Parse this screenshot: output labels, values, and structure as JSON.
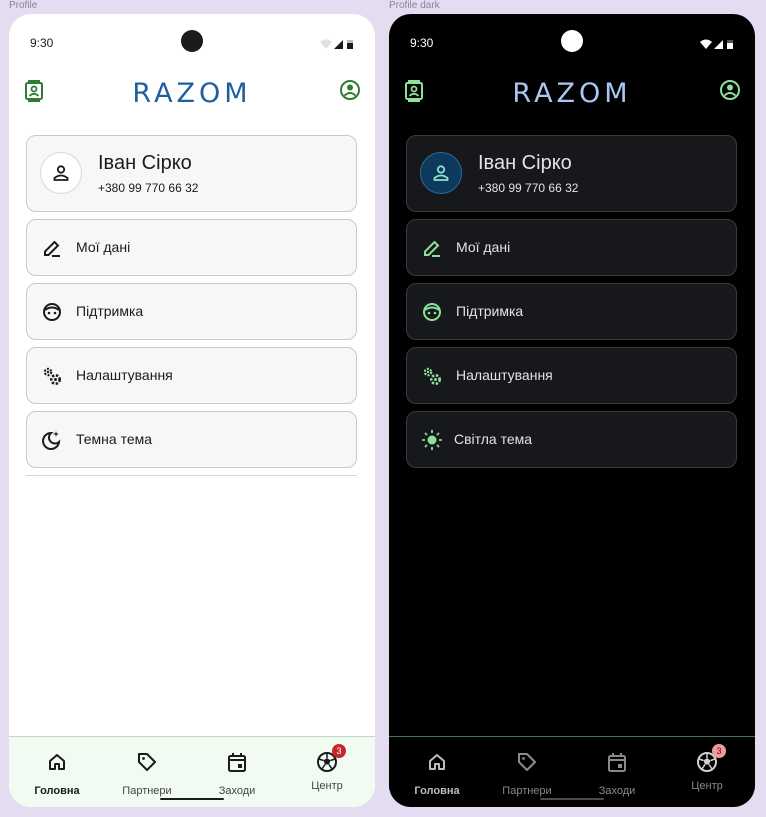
{
  "frames": {
    "light_label": "Profile",
    "dark_label": "Profile dark"
  },
  "status": {
    "time": "9:30"
  },
  "app": {
    "logo": "RAZOM"
  },
  "profile": {
    "name": "Іван Сірко",
    "phone": "+380 99 770 66 32"
  },
  "menu": {
    "my_data": "Мої дані",
    "support": "Підтримка",
    "settings": "Налаштування",
    "dark_theme": "Темна тема",
    "light_theme": "Світла тема"
  },
  "nav": {
    "home": "Головна",
    "partners": "Партнери",
    "events": "Заходи",
    "center": "Центр",
    "center_badge": "3"
  },
  "colors": {
    "light_accent": "#2e7d32",
    "dark_accent": "#8ee09a",
    "logo_light": "#1e5fa0",
    "logo_dark": "#a8c7f5"
  }
}
